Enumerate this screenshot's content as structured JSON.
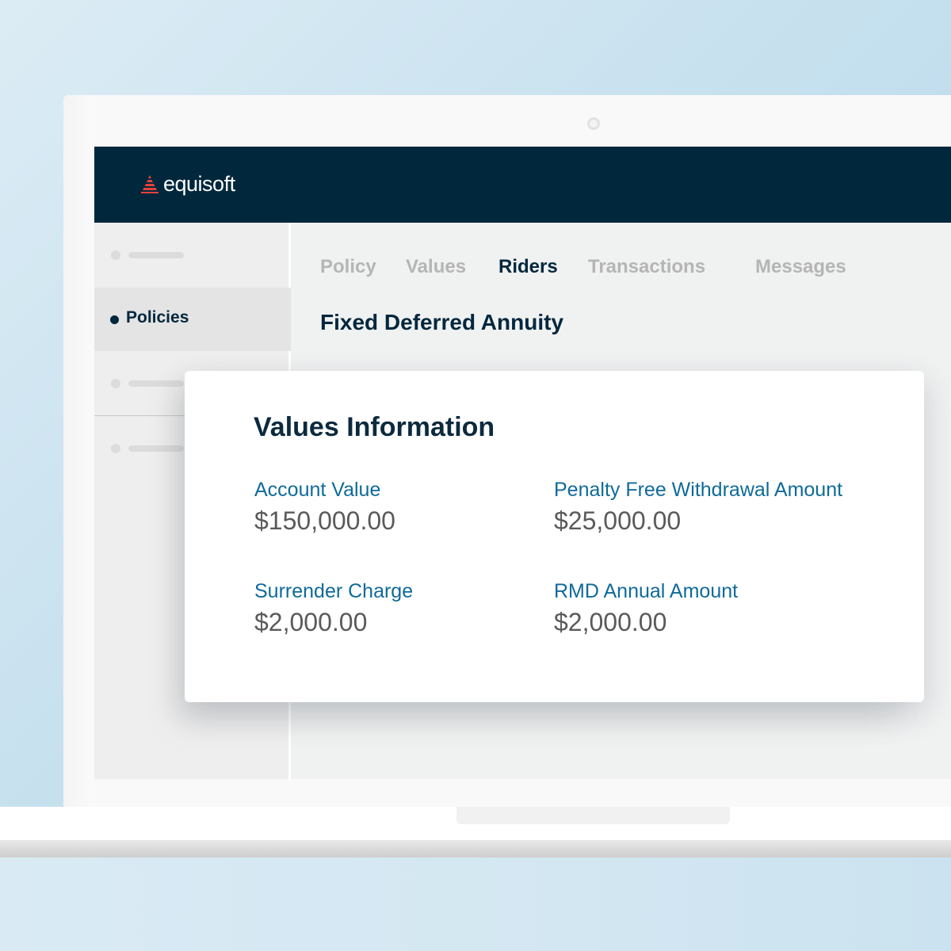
{
  "brand": {
    "name": "equisoft",
    "logo_color": "#e8423a",
    "header_color": "#01273d"
  },
  "sidebar": {
    "items": [
      {
        "label": "",
        "placeholder": true
      },
      {
        "label": "Policies",
        "active": true
      },
      {
        "label": "",
        "placeholder": true
      },
      {
        "label": "",
        "placeholder": true
      }
    ]
  },
  "tabs": [
    {
      "label": "Policy",
      "active": false
    },
    {
      "label": "Values",
      "active": false
    },
    {
      "label": "Riders",
      "active": true
    },
    {
      "label": "Transactions",
      "active": false
    },
    {
      "label": "Messages",
      "active": false
    }
  ],
  "page": {
    "title": "Fixed Deferred Annuity"
  },
  "card": {
    "title": "Values Information",
    "fields": [
      {
        "label": "Account Value",
        "value": "$150,000.00"
      },
      {
        "label": "Penalty Free Withdrawal Amount",
        "value": "$25,000.00"
      },
      {
        "label": "Surrender Charge",
        "value": "$2,000.00"
      },
      {
        "label": "RMD Annual Amount",
        "value": "$2,000.00"
      }
    ]
  },
  "colors": {
    "accent": "#106a9a",
    "tab_inactive": "#b5b5b5",
    "value_text": "#5a5a5a"
  }
}
